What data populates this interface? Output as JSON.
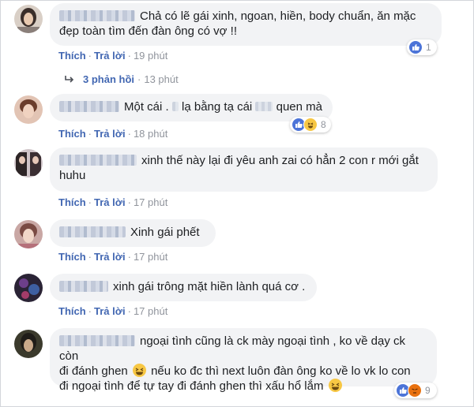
{
  "labels": {
    "like": "Thích",
    "reply": "Trả lời",
    "dot": "·"
  },
  "comments": [
    {
      "text_line1": "Chả có lẽ gái xinh, ngoan, hiền, body chuẩn, ăn mặc",
      "text_line2": "đẹp toàn tìm đến đàn ông có vợ !!",
      "time": "19 phút",
      "reaction_count": "1",
      "replies_count": "3 phản hồi",
      "replies_time": "13 phút"
    },
    {
      "text_a": "Một cái .",
      "text_b": "lạ bằng tạ cái",
      "text_c": "quen mà",
      "time": "18 phút",
      "reaction_count": "8"
    },
    {
      "text_line1": "xinh thế này lại đi yêu anh zai có hẳn 2 con r mới gắt",
      "text_line2": "huhu",
      "time": "17 phút"
    },
    {
      "text": "Xinh gái phết",
      "time": "17 phút"
    },
    {
      "text": "xinh gái trông mặt hiền lành quá cơ .",
      "time": "17 phút"
    },
    {
      "text_line1": "ngoại tình cũng là ck mày ngoại tình , ko về dạy ck còn",
      "text_line2a": "đi đánh ghen",
      "text_line2b": "nếu ko đc thì next luôn đàn ông ko về lo vk lo con",
      "text_line3": "đi ngoại tình để tự tay đi đánh ghen thì xấu hổ lắm",
      "time": "17 phút",
      "reaction_count": "9"
    }
  ],
  "colors": {
    "bubble": "#f2f3f5",
    "link": "#4267b2",
    "meta": "#90949c",
    "like": "#4c74d8",
    "haha": "#f7c744",
    "angry": "#e9710f"
  }
}
